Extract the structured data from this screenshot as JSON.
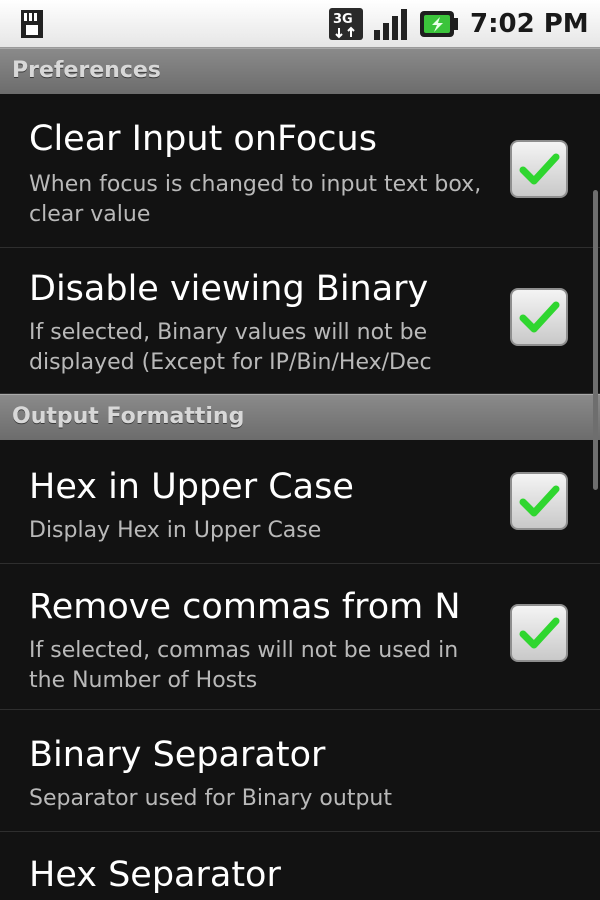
{
  "status_bar": {
    "time": "7:02 PM",
    "network_type": "3G",
    "icons": [
      "sd-card-icon",
      "network-3g-icon",
      "signal-icon",
      "battery-charging-icon"
    ]
  },
  "categories": [
    {
      "label": "Preferences"
    },
    {
      "label": "Output Formatting"
    }
  ],
  "preferences": [
    {
      "title": "Clear Input onFocus",
      "summary": "When focus is changed to input text box, clear value",
      "checked": true
    },
    {
      "title": "Disable viewing Binary",
      "summary": "If selected, Binary values will not be displayed (Except for IP/Bin/Hex/Dec",
      "checked": true
    },
    {
      "title": "Hex in Upper Case",
      "summary": "Display Hex in Upper Case",
      "checked": true
    },
    {
      "title": "Remove commas from N",
      "summary": "If selected, commas will not be used in the Number of Hosts",
      "checked": true
    },
    {
      "title": "Binary Separator",
      "summary": "Separator used for Binary output"
    },
    {
      "title": "Hex Separator",
      "summary": ""
    }
  ],
  "colors": {
    "check_green": "#2fd62f",
    "category_bg": "#7a7a7a",
    "row_bg": "#121212"
  }
}
